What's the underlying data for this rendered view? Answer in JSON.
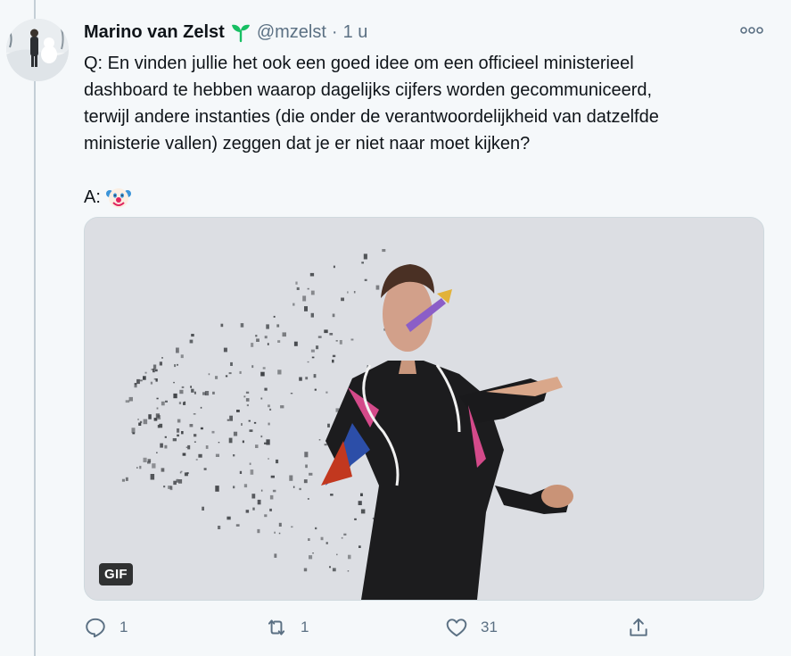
{
  "tweet": {
    "author": {
      "display_name": "Marino van Zelst",
      "handle": "@mzelst",
      "badge_icon": "sprout-icon"
    },
    "separator": "·",
    "time": "1 u",
    "more_icon": "more-icon",
    "text_lines": [
      "Q: En vinden jullie het ook een goed idee om een officieel ministerieel",
      "dashboard te hebben waarop dagelijks cijfers worden gecommuniceerd,",
      "terwijl andere instanties (die onder de verantwoordelijkheid van datzelfde",
      "ministerie vallen) zeggen dat je er niet naar moet kijken?"
    ],
    "answer_prefix": "A:",
    "answer_emoji": "clown-face-icon",
    "media": {
      "type": "gif",
      "badge": "GIF"
    },
    "actions": {
      "reply": {
        "icon": "reply-icon",
        "count": "1"
      },
      "retweet": {
        "icon": "retweet-icon",
        "count": "1"
      },
      "like": {
        "icon": "heart-icon",
        "count": "31"
      },
      "share": {
        "icon": "share-icon"
      }
    }
  },
  "colors": {
    "background": "#f5f8fa",
    "text": "#0f1419",
    "secondary_text": "#5b7083",
    "border": "#cfd9de",
    "sprout_green": "#17bf63"
  }
}
